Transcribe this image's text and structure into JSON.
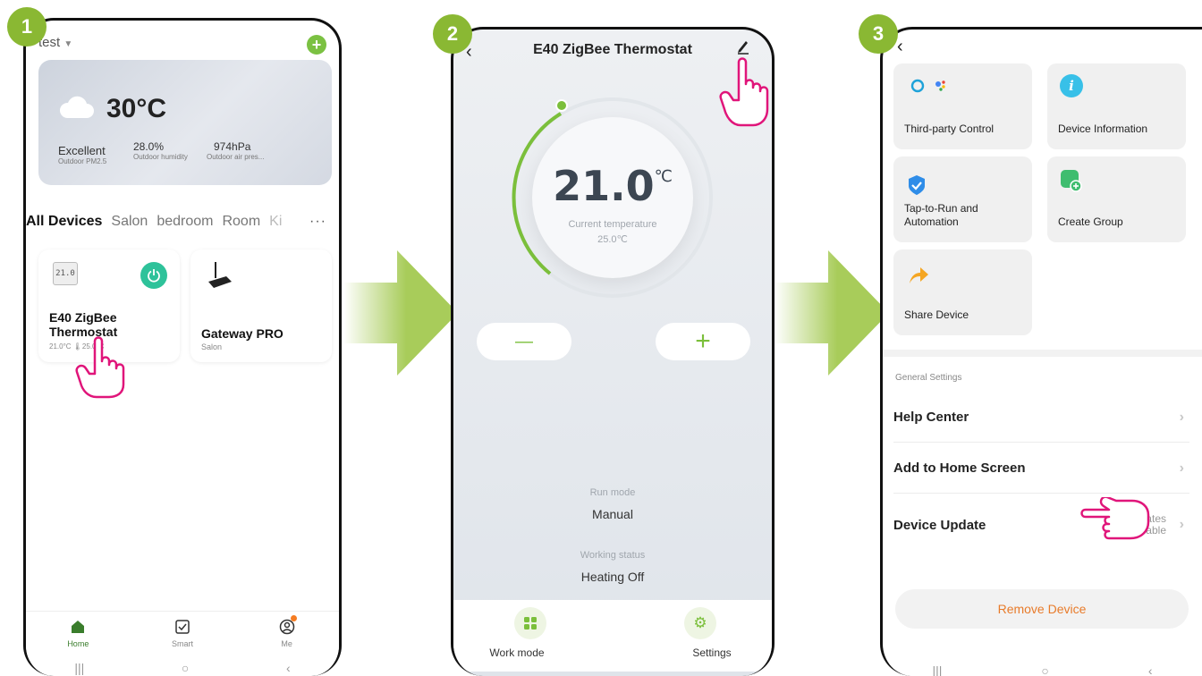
{
  "steps": [
    "1",
    "2",
    "3"
  ],
  "screen1": {
    "home_name": "test",
    "weather": {
      "temp": "30°C",
      "aq_value": "Excellent",
      "aq_label": "Outdoor PM2.5",
      "humidity_value": "28.0%",
      "humidity_label": "Outdoor humidity",
      "pressure_value": "974hPa",
      "pressure_label": "Outdoor air pres..."
    },
    "tabs": [
      "All Devices",
      "Salon",
      "bedroom",
      "Room",
      "Ki"
    ],
    "more": "···",
    "devices": [
      {
        "name": "E40 ZigBee Thermostat",
        "status": "21.0°C  🌡25.0°C"
      },
      {
        "name": "Gateway PRO",
        "room": "Salon"
      }
    ],
    "nav": [
      "Home",
      "Smart",
      "Me"
    ],
    "accent": "#3a7d2c"
  },
  "screen2": {
    "title": "E40 ZigBee Thermostat",
    "setpoint_int": "21",
    "setpoint_dec": ".0",
    "unit": "℃",
    "current_label": "Current temperature",
    "current_value": "25.0℃",
    "minus": "—",
    "plus": "+",
    "run_mode_label": "Run mode",
    "run_mode_value": "Manual",
    "working_label": "Working status",
    "working_value": "Heating Off",
    "bottom": [
      "Work mode",
      "Settings"
    ],
    "accent": "#7bbf3b"
  },
  "screen3": {
    "tiles": [
      "Third-party Control",
      "Device Information",
      "Tap-to-Run and Automation",
      "Create Group",
      "Share Device"
    ],
    "section": "General Settings",
    "rows": [
      "Help Center",
      "Add to Home Screen",
      "Device Update"
    ],
    "update_status": "No updates available",
    "remove": "Remove Device",
    "remove_color": "#e87b2a"
  },
  "arrow_color": "#a8cc5a",
  "hand_color": "#e0157a"
}
